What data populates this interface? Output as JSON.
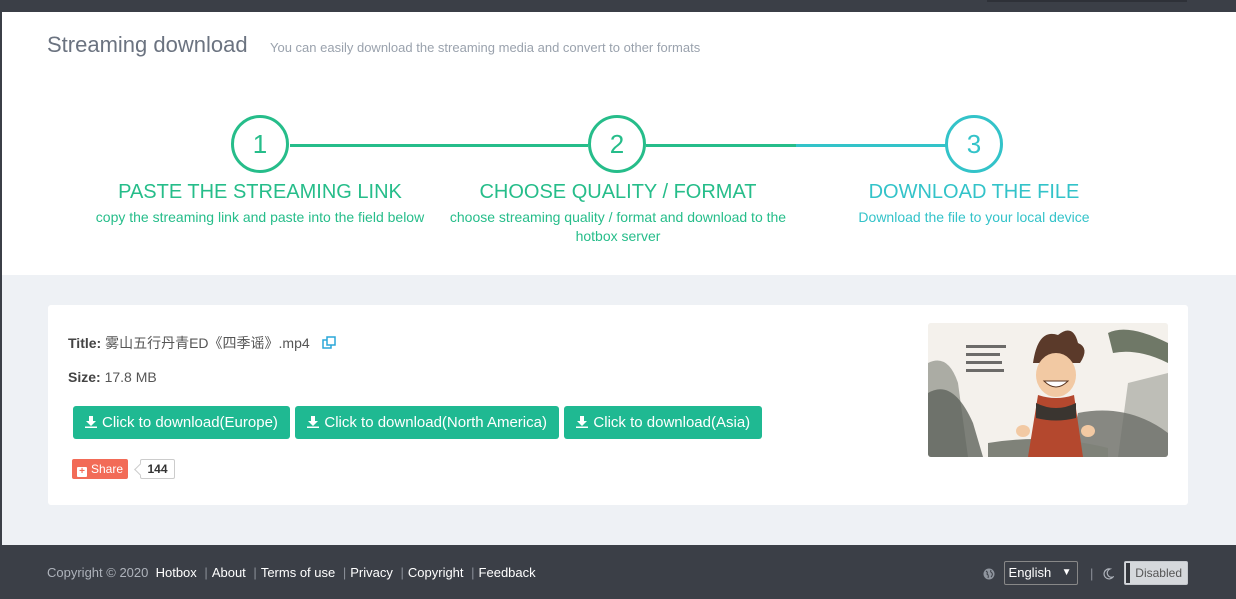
{
  "header": {
    "title": "Streaming download",
    "subtitle": "You can easily download the streaming media and convert to other formats"
  },
  "steps": [
    {
      "number": "1",
      "title": "PASTE THE STREAMING LINK",
      "description": "copy the streaming link and paste into the field below"
    },
    {
      "number": "2",
      "title": "CHOOSE QUALITY / FORMAT",
      "description": "choose streaming quality / format and download to the hotbox server"
    },
    {
      "number": "3",
      "title": "DOWNLOAD THE FILE",
      "description": "Download the file to your local device"
    }
  ],
  "file": {
    "title_label": "Title:",
    "title_value": "雾山五行丹青ED《四季谣》.mp4",
    "size_label": "Size:",
    "size_value": "17.8 MB"
  },
  "download_buttons": [
    {
      "label": "Click to download(Europe)"
    },
    {
      "label": "Click to download(North America)"
    },
    {
      "label": "Click to download(Asia)"
    }
  ],
  "share": {
    "label": "Share",
    "count": "144"
  },
  "footer": {
    "copyright": "Copyright © 2020",
    "links": [
      "Hotbox",
      "About",
      "Terms of use",
      "Privacy",
      "Copyright",
      "Feedback"
    ],
    "language": "English",
    "dark_mode_state": "Disabled"
  },
  "colors": {
    "accent_green": "#26bd8a",
    "accent_teal": "#33c3c9",
    "button_green": "#1fb992",
    "share_red": "#f26b57",
    "footer_bg": "#3b3f47"
  },
  "icons": [
    "copy-icon",
    "download-icon",
    "plus-icon",
    "globe-icon",
    "moon-icon"
  ]
}
